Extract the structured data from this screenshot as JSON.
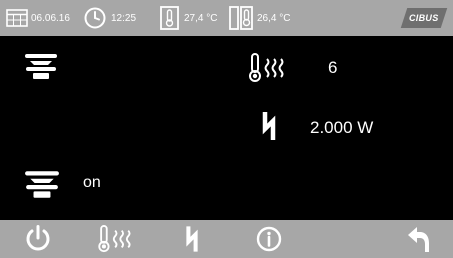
{
  "status": {
    "date": "06.06.16",
    "time": "12:25",
    "temp_inside": "27,4 °C",
    "temp_outside": "26,4 °C",
    "logo": "CIBUS",
    "icons": [
      "calendar-icon",
      "clock-icon",
      "thermometer-icon",
      "dual-thermometer-icon"
    ]
  },
  "main": {
    "heat_level": "6",
    "power": "2.000 W",
    "hob_state": "on",
    "icons": [
      "hob-icon",
      "heat-thermometer-icon",
      "power-icon"
    ]
  },
  "toolbar": {
    "buttons": [
      "power-button",
      "heat-button",
      "power-level-button",
      "info-button",
      "back-button"
    ]
  },
  "colors": {
    "bar": "#a7a7a7",
    "background": "#000000",
    "text": "#ffffff",
    "logo_badge": "#6f6f6f"
  }
}
